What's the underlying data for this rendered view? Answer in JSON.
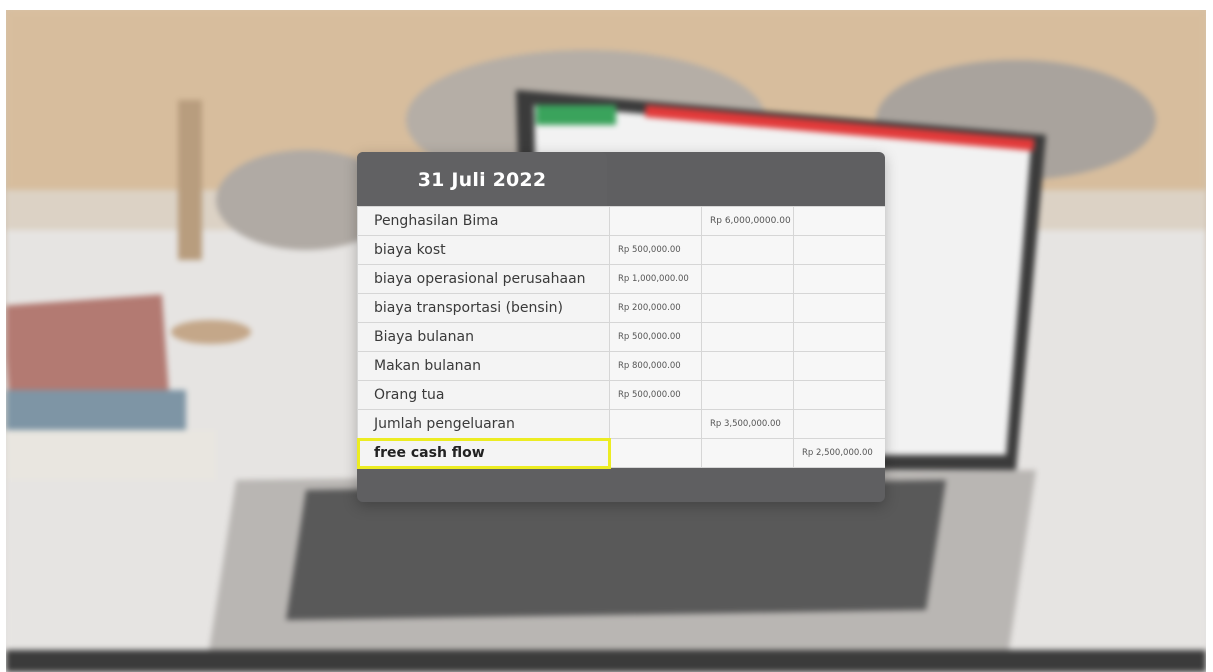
{
  "card": {
    "title": "31 Juli 2022"
  },
  "rows": [
    {
      "label": "Penghasilan Bima",
      "col_a": "",
      "col_b": "Rp 6,000,0000.00",
      "col_c": ""
    },
    {
      "label": "biaya kost",
      "col_a": "Rp 500,000.00",
      "col_b": "",
      "col_c": ""
    },
    {
      "label": "biaya operasional perusahaan",
      "col_a": "Rp 1,000,000.00",
      "col_b": "",
      "col_c": ""
    },
    {
      "label": "biaya transportasi (bensin)",
      "col_a": "Rp 200,000.00",
      "col_b": "",
      "col_c": ""
    },
    {
      "label": "Biaya bulanan",
      "col_a": "Rp 500,000.00",
      "col_b": "",
      "col_c": ""
    },
    {
      "label": "Makan bulanan",
      "col_a": "Rp 800,000.00",
      "col_b": "",
      "col_c": ""
    },
    {
      "label": "Orang tua",
      "col_a": "Rp 500,000.00",
      "col_b": "",
      "col_c": ""
    },
    {
      "label": "Jumlah pengeluaran",
      "col_a": "",
      "col_b": "Rp 3,500,000.00",
      "col_c": ""
    },
    {
      "label": "free cash flow",
      "col_a": "",
      "col_b": "",
      "col_c": "Rp 2,500,000.00"
    }
  ],
  "highlight": {
    "row": "free cash flow",
    "color": "#ecec22"
  },
  "colors": {
    "card_bg": "#5f5f61",
    "cell_bg": "#f7f7f7"
  }
}
